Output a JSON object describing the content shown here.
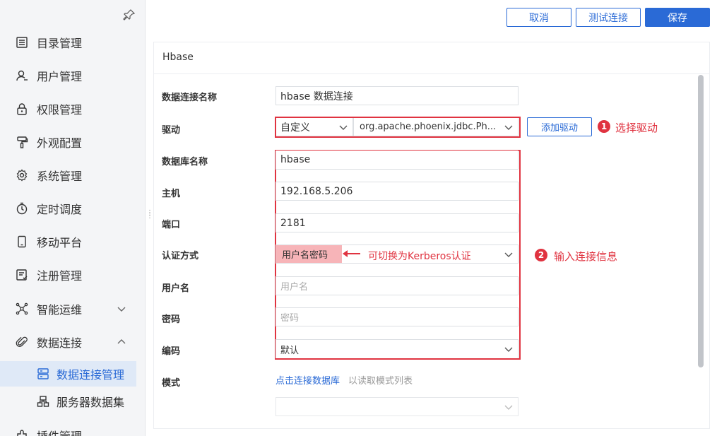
{
  "sidebar": {
    "items": [
      {
        "label": "目录管理",
        "icon": "list-icon"
      },
      {
        "label": "用户管理",
        "icon": "user-icon"
      },
      {
        "label": "权限管理",
        "icon": "lock-icon"
      },
      {
        "label": "外观配置",
        "icon": "paint-roller-icon"
      },
      {
        "label": "系统管理",
        "icon": "gear-icon"
      },
      {
        "label": "定时调度",
        "icon": "stopwatch-icon"
      },
      {
        "label": "移动平台",
        "icon": "mobile-icon"
      },
      {
        "label": "注册管理",
        "icon": "register-icon"
      },
      {
        "label": "智能运维",
        "icon": "network-icon"
      },
      {
        "label": "数据连接",
        "icon": "paperclip-icon"
      }
    ],
    "sub_items": [
      {
        "label": "数据连接管理",
        "icon": "database-icon",
        "active": true
      },
      {
        "label": "服务器数据集",
        "icon": "server-dataset-icon",
        "active": false
      }
    ],
    "partial_item": {
      "label": "插件管理",
      "icon": "plugin-icon"
    }
  },
  "toolbar": {
    "cancel_label": "取消",
    "test_label": "测试连接",
    "save_label": "保存"
  },
  "panel": {
    "title": "Hbase"
  },
  "form": {
    "connection_name": {
      "label": "数据连接名称",
      "value": "hbase 数据连接"
    },
    "driver": {
      "label": "驱动",
      "type_value": "自定义",
      "class_value": "org.apache.phoenix.jdbc.Ph...",
      "add_driver_label": "添加驱动"
    },
    "database_name": {
      "label": "数据库名称",
      "value": "hbase"
    },
    "host": {
      "label": "主机",
      "value": "192.168.5.206"
    },
    "port": {
      "label": "端口",
      "value": "2181"
    },
    "auth": {
      "label": "认证方式",
      "value": "用户名密码"
    },
    "username": {
      "label": "用户名",
      "placeholder": "用户名"
    },
    "password": {
      "label": "密码",
      "placeholder": "密码"
    },
    "encoding": {
      "label": "编码",
      "value": "默认"
    },
    "schema": {
      "label": "模式",
      "link_text": "点击连接数据库",
      "hint_text": "以读取模式列表",
      "value": ""
    }
  },
  "annotations": {
    "step1_number": "1",
    "step1_text": "选择驱动",
    "step2_number": "2",
    "step2_text": "输入连接信息",
    "auth_note": "可切换为Kerberos认证"
  },
  "colors": {
    "accent": "#2a6ad6",
    "annotation_red": "#e03340",
    "highlight": "#f7b4b8"
  }
}
